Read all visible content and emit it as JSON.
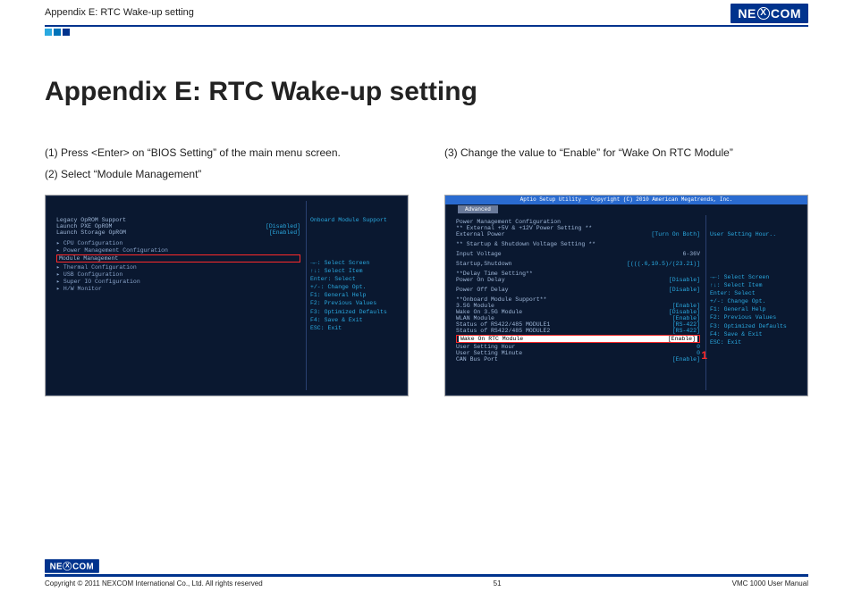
{
  "header": {
    "breadcrumb": "Appendix E: RTC Wake-up setting"
  },
  "brand": {
    "pre": "NE",
    "mid": "X",
    "post": "COM"
  },
  "title": "Appendix E: RTC Wake-up setting",
  "left": {
    "step1": "(1) Press <Enter> on “BIOS Setting” of the main menu screen.",
    "step2": "(2) Select “Module Management”",
    "bios": {
      "section": "Legacy OpROM Support",
      "r1_label": "Launch PXE OpROM",
      "r1_val": "[Disabled]",
      "r2_label": "Launch Storage OpROM",
      "r2_val": "[Enabled]",
      "m1": "CPU Configuration",
      "m2": "Power Management Configuration",
      "m3_label": "Module Management",
      "m4": "Thermal Configuration",
      "m5": "USB Configuration",
      "m6": "Super IO Configuration",
      "m7": "H/W Monitor",
      "side_title": "Onboard Module Support",
      "h1": "→←: Select Screen",
      "h2": "↑↓: Select Item",
      "h3": "Enter: Select",
      "h4": "+/-: Change Opt.",
      "h5": "F1: General Help",
      "h6": "F2: Previous Values",
      "h7": "F3: Optimized Defaults",
      "h8": "F4: Save & Exit",
      "h9": "ESC: Exit"
    }
  },
  "right": {
    "step": "(3) Change the value to “Enable” for “Wake On RTC Module”",
    "bios": {
      "topbar": "Aptio Setup Utility - Copyright (C) 2010 American Megatrends, Inc.",
      "tab": "Advanced",
      "s1": "Power Management Configuration",
      "s2": "** External +5V & +12V Power Setting **",
      "s3_l": "External Power",
      "s3_v": "[Turn On Both]",
      "s4": "** Startup & Shutdown Voltage Setting **",
      "s5_l": "Input Voltage",
      "s5_v": "6-36V",
      "s6_l": "Startup,Shutdown",
      "s6_v": "[(((.6,10.5)/(23.21)]",
      "s7": "**Delay Time Setting**",
      "s8_l": "Power On Delay",
      "s8_v": "[Disable]",
      "s9_l": "Power Off Delay",
      "s9_v": "[Disable]",
      "s10": "**Onboard Module Support**",
      "s11_l": "3.5G Module",
      "s11_v": "[Enable]",
      "s12_l": "Wake On 3.5G Module",
      "s12_v": "[Disable]",
      "s13_l": "WLAN Module",
      "s13_v": "[Enable]",
      "s14_l": "Status of RS422/485 MODULE1",
      "s14_v": "[RS-422]",
      "s15_l": "Status of RS422/485 MODULE2",
      "s15_v": "[RS-422]",
      "sel_l": "Wake On RTC Module",
      "sel_v": "[Enable]",
      "s16_l": "User Setting Hour",
      "s16_v": "0",
      "s17_l": "User Setting Minute",
      "s17_v": "0",
      "s18_l": "CAN Bus Port",
      "s18_v": "[Enable]",
      "side_title": "User Setting Hour..",
      "h1": "→←: Select Screen",
      "h2": "↑↓: Select Item",
      "h3": "Enter: Select",
      "h4": "+/-: Change Opt.",
      "h5": "F1: General Help",
      "h6": "F2: Previous Values",
      "h7": "F3: Optimized Defaults",
      "h8": "F4: Save & Exit",
      "h9": "ESC: Exit",
      "annotation": "1"
    }
  },
  "footer": {
    "copyright": "Copyright © 2011 NEXCOM International Co., Ltd. All rights reserved",
    "page": "51",
    "manual": "VMC 1000 User Manual"
  }
}
